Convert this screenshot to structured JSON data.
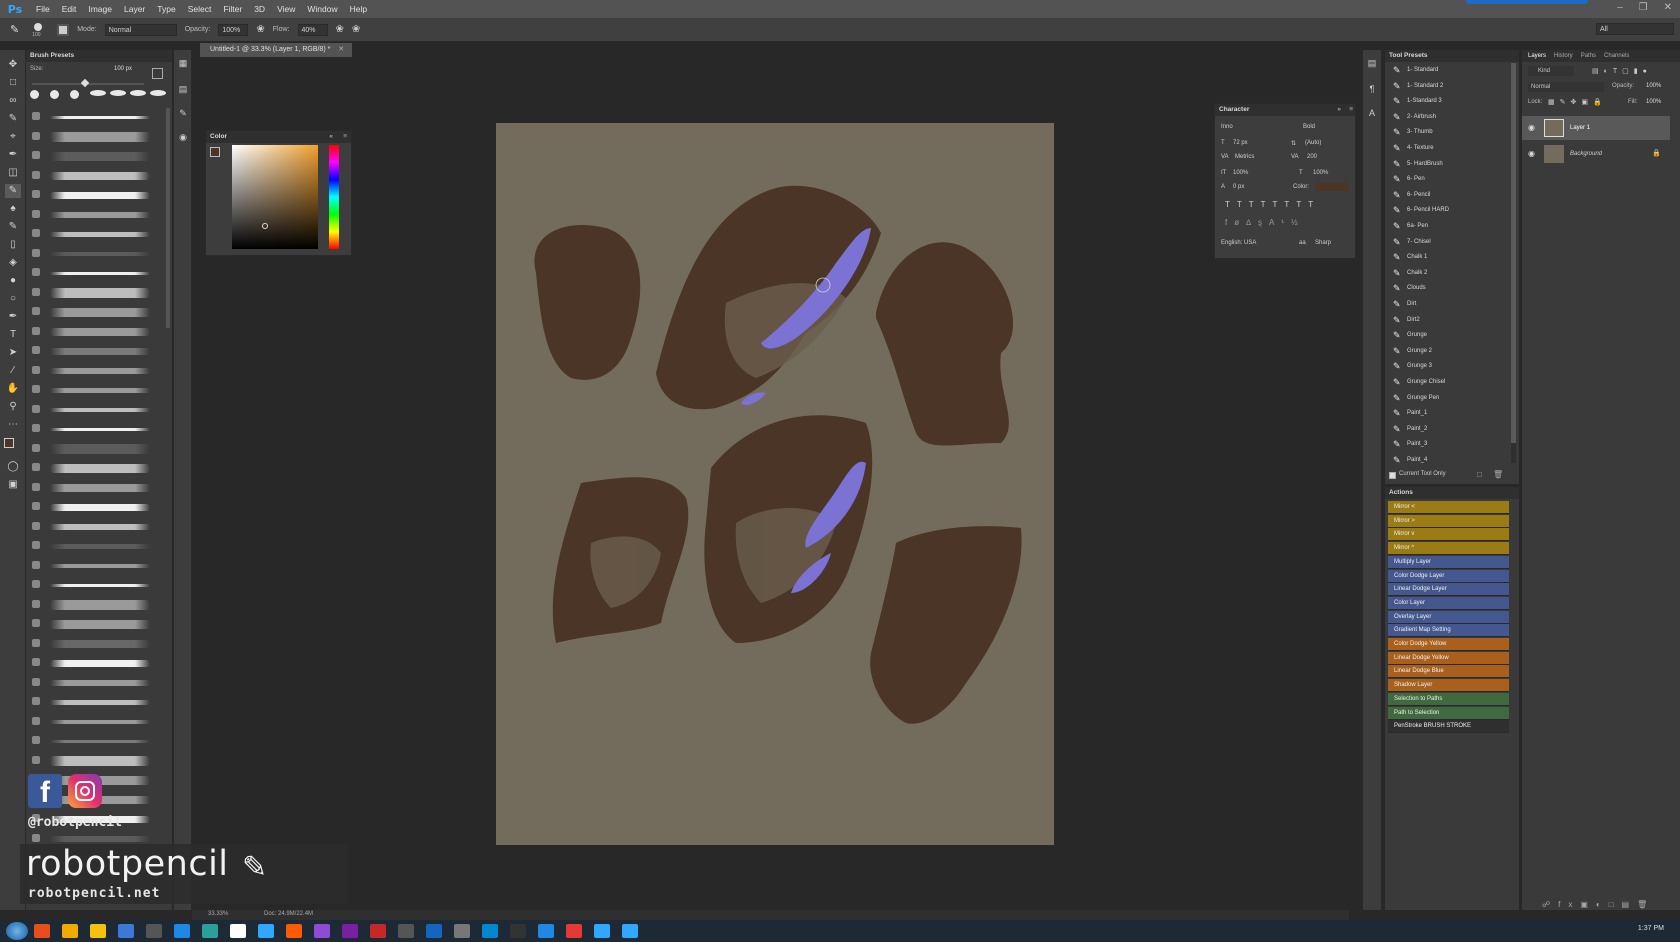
{
  "app": {
    "logo": "Ps",
    "menu": [
      "File",
      "Edit",
      "Image",
      "Layer",
      "Type",
      "Select",
      "Filter",
      "3D",
      "View",
      "Window",
      "Help"
    ],
    "workspace": "All"
  },
  "options_bar": {
    "brush_size": "100",
    "mode_label": "Mode:",
    "mode_value": "Normal",
    "opacity_label": "Opacity:",
    "opacity_value": "100%",
    "flow_label": "Flow:",
    "flow_value": "40%"
  },
  "document": {
    "tab_title": "Untitled-1 @ 33.3% (Layer 1, RGB/8) *",
    "zoom": "33.33%",
    "doc_size": "Doc: 24.9M/22.4M"
  },
  "brush_presets": {
    "title": "Brush Presets",
    "size_label": "Size:",
    "size_value": "100 px"
  },
  "color_panel": {
    "title": "Color"
  },
  "character_panel": {
    "title": "Character",
    "font_family": "Inno",
    "font_style": "Bold",
    "font_size": "72 px",
    "leading": "(Auto)",
    "kerning": "Metrics",
    "tracking": "200",
    "vscale": "100%",
    "hscale": "100%",
    "baseline": "0 px",
    "color_label": "Color:",
    "language": "English: USA",
    "antialias": "Sharp"
  },
  "tool_presets": {
    "title": "Tool Presets",
    "items": [
      "1- Standard",
      "1- Standard 2",
      "1-Standard 3",
      "2- Airbrush",
      "3- Thumb",
      "4- Texture",
      "5- HardBrush",
      "6- Pen",
      "6- Pencil",
      "6- Pencil HARD",
      "6a- Pen",
      "7- Chisel",
      "Chalk 1",
      "Chalk 2",
      "Clouds",
      "Dirt",
      "Dirt2",
      "Grunge",
      "Grunge 2",
      "Grunge 3",
      "Grunge Chisel",
      "Grunge Pen",
      "Paint_1",
      "Paint_2",
      "Paint_3",
      "Paint_4"
    ],
    "current_tool_only": "Current Tool Only"
  },
  "actions": {
    "title": "Actions",
    "items": [
      {
        "label": "Mirror <",
        "color": "#9a7b14"
      },
      {
        "label": "Mirror >",
        "color": "#9a7b14"
      },
      {
        "label": "Mirror v",
        "color": "#9a7b14"
      },
      {
        "label": "Mirror ^",
        "color": "#9a7b14"
      },
      {
        "label": "Multiply Layer",
        "color": "#44578f"
      },
      {
        "label": "Color Dodge Layer",
        "color": "#44578f"
      },
      {
        "label": "Linear Dodge Layer",
        "color": "#44578f"
      },
      {
        "label": "Color Layer",
        "color": "#44578f"
      },
      {
        "label": "Overlay Layer",
        "color": "#44578f"
      },
      {
        "label": "Gradient Map Setting",
        "color": "#44578f"
      },
      {
        "label": "Color Dodge Yellow",
        "color": "#a8601c"
      },
      {
        "label": "Linear Dodge Yellow",
        "color": "#a8601c"
      },
      {
        "label": "Linear Dodge Blue",
        "color": "#a8601c"
      },
      {
        "label": "Shadow Layer",
        "color": "#a8601c"
      },
      {
        "label": "Selection to Paths",
        "color": "#3f6a3f"
      },
      {
        "label": "Path to Selection",
        "color": "#3f6a3f"
      },
      {
        "label": "PenStroke BRUSH STROKE",
        "color": "#2f2f2f"
      }
    ]
  },
  "layers_panel": {
    "tabs": [
      "Layers",
      "History",
      "Paths",
      "Channels"
    ],
    "filter": "Kind",
    "blend_mode": "Normal",
    "opacity_label": "Opacity:",
    "opacity_value": "100%",
    "lock_label": "Lock:",
    "fill_label": "Fill:",
    "fill_value": "100%",
    "layers": [
      "Layer 1",
      "Background"
    ]
  },
  "watermark": {
    "handle": "@robotpencil",
    "name": "robotpencil",
    "url": "robotpencil.net"
  },
  "taskbar": {
    "time": "1:37 PM"
  },
  "colors": {
    "canvas_bg": "#736c5d",
    "paint_brown": "#4a3526",
    "paint_violet": "#7b72d4",
    "accent_blue": "#31a8ff"
  }
}
